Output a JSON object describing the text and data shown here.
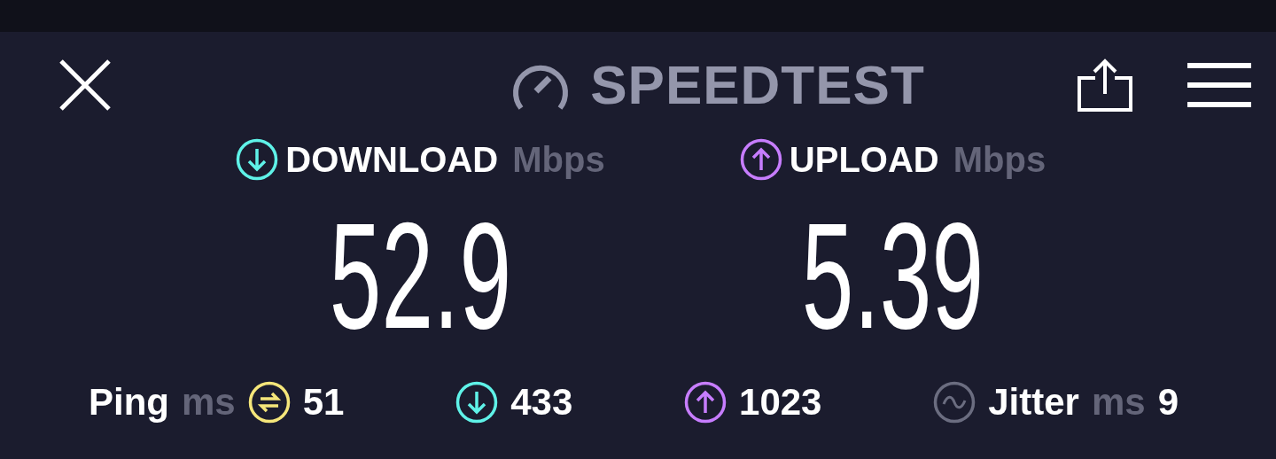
{
  "header": {
    "title": "SPEEDTEST"
  },
  "results": [
    {
      "kind": "download",
      "label": "DOWNLOAD",
      "unit": "Mbps",
      "value": "52.9",
      "color": "#5ff2e8"
    },
    {
      "kind": "upload",
      "label": "UPLOAD",
      "unit": "Mbps",
      "value": "5.39",
      "color": "#c77dff"
    }
  ],
  "stats": [
    {
      "kind": "ping",
      "label": "Ping",
      "unit": "ms",
      "value": "51",
      "color": "#f5e67a"
    },
    {
      "kind": "download",
      "value": "433",
      "color": "#5ff2e8"
    },
    {
      "kind": "upload",
      "value": "1023",
      "color": "#c77dff"
    },
    {
      "kind": "jitter",
      "label": "Jitter",
      "unit": "ms",
      "value": "9",
      "color": "#6b6d80"
    }
  ]
}
